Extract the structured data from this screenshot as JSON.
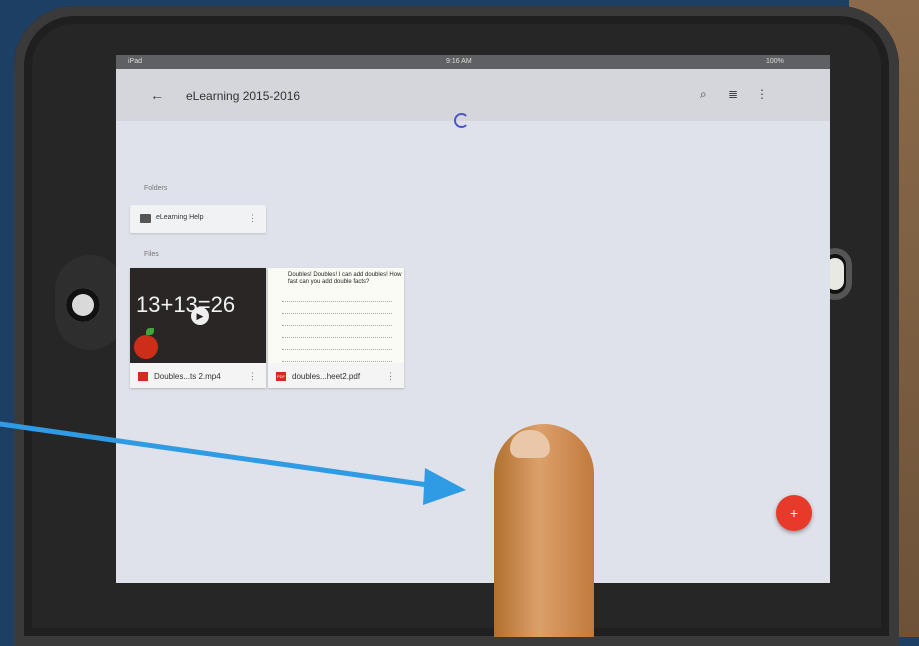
{
  "statusbar": {
    "left": "iPad",
    "time": "9:16 AM",
    "battery": "100%"
  },
  "appbar": {
    "title": "eLearning 2015-2016",
    "back_icon": "arrow-left-icon",
    "search_icon": "search-icon",
    "list_icon": "list-view-icon",
    "more_icon": "more-vert-icon"
  },
  "sections": {
    "folders": "Folders",
    "files": "Files"
  },
  "folder": {
    "name": "eLearning Help"
  },
  "files": [
    {
      "name": "Doubles...ts 2.mp4",
      "video_text": "13+13=26"
    },
    {
      "name": "doubles...heet2.pdf",
      "pdf_title": "Doubles! Doubles! I can add doubles! How fast can you add double facts?",
      "pdf_badge": "PDF"
    }
  ],
  "fab": {
    "label": "+"
  },
  "colors": {
    "accent": "#4b57c6",
    "fab": "#e83a2b",
    "arrow": "#2f9be4"
  }
}
